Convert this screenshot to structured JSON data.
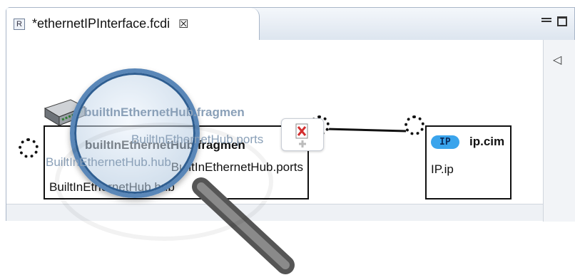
{
  "editor": {
    "tab_title": "*ethernetIPInterface.fcdi",
    "tab_icon_letter": "R",
    "close_glyph": "☒"
  },
  "diagram": {
    "node_a": {
      "title": "builtInEthernetHub.fragmen",
      "ports_label": "BuiltInEthernetHub.ports",
      "hub_label": "BuiltInEthernetHub.hub"
    },
    "node_b": {
      "badge": "IP",
      "title": "ip.cim",
      "ip_label": "IP.ip"
    }
  },
  "colors": {
    "accent": "#3aa4ec",
    "lens_ring": "#5a87b8"
  },
  "icons": {
    "tab": "resource-icon",
    "device": "ethernet-hub-icon",
    "tool": "delete-icon",
    "scroll_arrow": "triangle-left-icon"
  }
}
